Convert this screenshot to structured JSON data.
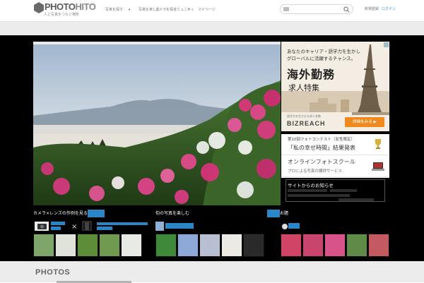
{
  "header": {
    "logo_main": "PHOTO",
    "logo_accent": "HITO",
    "logo_sub": "人と写真をつなぐ場所",
    "nav": [
      "写真を探す",
      "写真を楽しむ",
      "カメラを探す",
      "コミュニティ",
      "マイページ"
    ],
    "register": "新規登録",
    "login": "ログイン",
    "search_placeholder": ""
  },
  "ad": {
    "line1": "あなたのキャリア・語学力を生かし",
    "line2": "グローバルに活躍するチャンス。",
    "headline": "海外勤務",
    "sub": "求人特集",
    "small": "語学力を生かせる求人多数",
    "brand": "BIZREACH",
    "cta": "詳細をみる ▶"
  },
  "promo": {
    "contest_small": "第10回フォトコンテスト（女性限定）",
    "contest_title": "「私の幸せ時間」結果発表",
    "school_title": "オンラインフォトスクール",
    "school_sub": "プロによる写真の講評サービス"
  },
  "news": {
    "title": "サイトからのお知らせ"
  },
  "sections": {
    "camera": {
      "label": "カメラ×レンズの作例を見る",
      "link": ""
    },
    "flowers": {
      "label": "旬の写真を楽しむ",
      "link": ""
    },
    "topic": {
      "label": "お題",
      "link": ""
    }
  },
  "footer": {
    "photos_heading": "PHOTOS"
  },
  "colors": {
    "accent_blue": "#2b86c5",
    "cta_orange": "#f08a1e",
    "stage_bg": "#000000"
  }
}
